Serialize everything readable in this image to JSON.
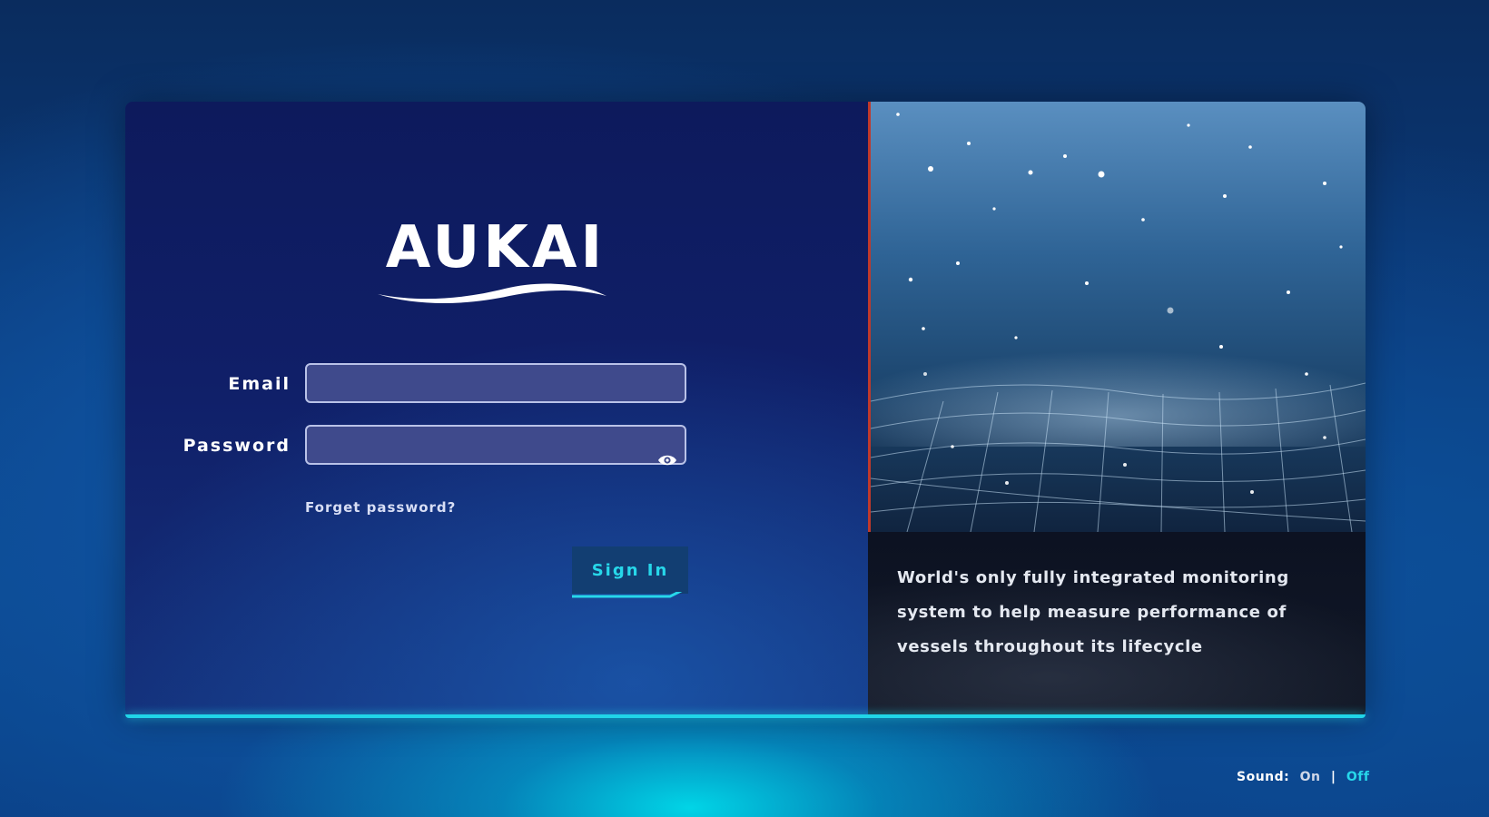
{
  "brand": {
    "logo_text": "AUKAI"
  },
  "login": {
    "email_label": "Email",
    "email_value": "",
    "password_label": "Password",
    "password_value": "",
    "forgot_link": "Forget password?",
    "signin_label": "Sign In"
  },
  "hero": {
    "caption": "World's only fully integrated monitoring system to help measure performance of vessels throughout its lifecycle"
  },
  "sound": {
    "label": "Sound:",
    "on_label": "On",
    "separator": "|",
    "off_label": "Off",
    "active": "Off"
  },
  "colors": {
    "accent_cyan": "#27d7ea",
    "panel_navy": "#0d1a5c",
    "divider_red": "#c0392b",
    "input_bg": "#3f4a8c"
  },
  "icons": {
    "password_toggle": "eye-icon"
  }
}
